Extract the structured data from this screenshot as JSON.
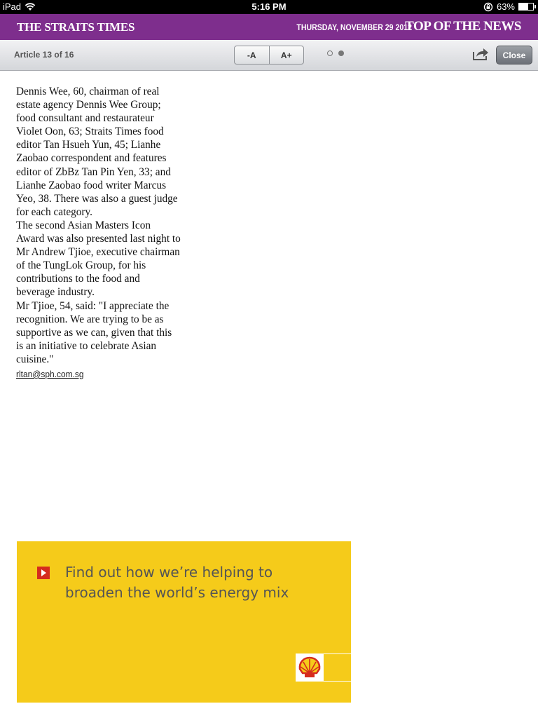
{
  "status_bar": {
    "device": "iPad",
    "time": "5:16 PM",
    "battery_percent": "63%",
    "battery_level": 0.63,
    "icons": [
      "wifi-icon",
      "rotation-lock-icon",
      "battery-icon"
    ]
  },
  "masthead": {
    "logo": "THE STRAITS TIMES",
    "date": "THURSDAY, NOVEMBER 29 2012",
    "section": "TOP OF THE NEWS",
    "color": "#7e2e8d"
  },
  "toolbar": {
    "article_counter": "Article 13 of 16",
    "font_decrease_label": "-A",
    "font_increase_label": "A+",
    "page_indicator": {
      "total": 2,
      "current": 2
    },
    "share_icon": "share-icon",
    "close_label": "Close"
  },
  "article": {
    "paragraphs": [
      "Dennis Wee, 60, chairman of real estate agency Dennis Wee Group; food consultant and restaurateur Violet Oon, 63; Straits Times food editor Tan Hsueh Yun, 45; Lianhe Zaobao correspondent and features editor of ZbBz Tan Pin Yen, 33; and Lianhe Zaobao food writer Marcus Yeo, 38. There was also a guest judge for each category.",
      " The second Asian Masters Icon Award was also presented last night to Mr Andrew Tjioe, executive chairman of the TungLok Group, for his contributions to the food and beverage industry.",
      " Mr Tjioe, 54, said: \"I appreciate the recognition. We are trying to be as supportive as we can, given that this is an initiative to celebrate Asian cuisine.\""
    ],
    "email": "rltan@sph.com.sg"
  },
  "ad": {
    "headline_line1": "Find out how we’re helping to",
    "headline_line2": "broaden the world’s energy mix",
    "background": "#f5cb1a",
    "brand_icon": "shell-logo-icon"
  }
}
